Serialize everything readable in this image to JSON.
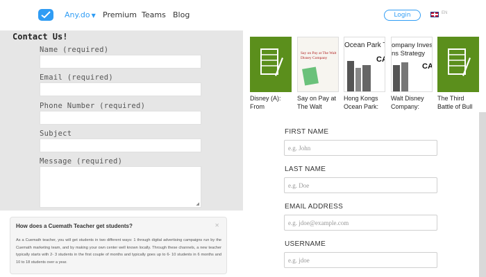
{
  "nav": {
    "brand": "Any.do",
    "links": [
      "Premium",
      "Teams",
      "Blog"
    ],
    "login": "Login",
    "lang": "EN"
  },
  "contact": {
    "title": "Contact Us!",
    "fields": [
      {
        "label": "Name (required)"
      },
      {
        "label": "Email (required)"
      },
      {
        "label": "Phone Number (required)"
      },
      {
        "label": "Subject"
      },
      {
        "label": "Message (required)"
      }
    ]
  },
  "cuemath": {
    "question": "How does a Cuemath Teacher get students?",
    "answer": "As a Cuemath teacher, you will get students in two different ways: 1 through digital advertising campaigns run by the Cuemath marketing team, and by making your own center well known locally. Through these channels, a new teacher typically starts with 2- 3 students in the first couple of months and typically goes up to 6- 10 students in 6 months and 10 to 18 students over a year."
  },
  "books": [
    {
      "title": "Disney (A): From",
      "cover_text": ""
    },
    {
      "title": "Say on Pay at The Walt",
      "cover_text": "Say on Pay at The Walt Disney Company"
    },
    {
      "title": "Hong Kongs Ocean Park:",
      "cover_text": "Ocean Park Tal"
    },
    {
      "title": "Walt Disney Company:",
      "cover_text": "ompany Inves ns Strategy"
    },
    {
      "title": "The Third Battle of Bull Run: The",
      "cover_text": ""
    }
  ],
  "book_cover_badge": "CA",
  "form": {
    "first_name_label": "FIRST NAME",
    "first_name_placeholder": "e.g. John",
    "last_name_label": "LAST NAME",
    "last_name_placeholder": "e.g. Doe",
    "email_label": "EMAIL ADDRESS",
    "email_placeholder": "e.g. jdoe@example.com",
    "username_label": "USERNAME",
    "username_placeholder": "e.g. jdoe"
  },
  "colors": {
    "accent": "#2f9cf4",
    "book_green": "#5b8f1c",
    "panel_gray": "#e6e6e6"
  }
}
